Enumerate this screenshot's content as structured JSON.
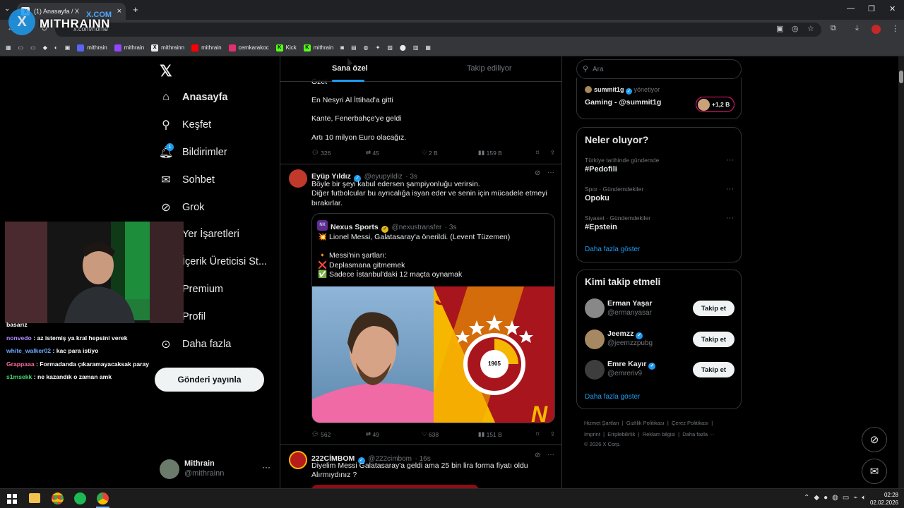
{
  "browser": {
    "tab_title": "(1) Anasayfa / X",
    "url": "x.com/home",
    "new_tab": "+",
    "bookmarks": [
      {
        "label": "mithrain",
        "color": "#5865f2"
      },
      {
        "label": "mithrain",
        "color": "#9146ff"
      },
      {
        "label": "mithrainn",
        "color": "#e7e9ea"
      },
      {
        "label": "mithrain",
        "color": "#ff0000"
      },
      {
        "label": "cemkarakoc",
        "color": "#e1306c"
      },
      {
        "label": "Kick",
        "color": "#53fc18"
      },
      {
        "label": "mithrain",
        "color": "#53fc18"
      }
    ]
  },
  "watermark": {
    "name": "MITHRAINN",
    "domain": "X.COM",
    "logo": "X"
  },
  "nav": {
    "items": [
      {
        "label": "Anasayfa",
        "icon": "home-icon"
      },
      {
        "label": "Keşfet",
        "icon": "search-icon"
      },
      {
        "label": "Bildirimler",
        "icon": "bell-icon",
        "badge": "1"
      },
      {
        "label": "Sohbet",
        "icon": "mail-icon"
      },
      {
        "label": "Grok",
        "icon": "grok-icon"
      },
      {
        "label": "Yer İşaretleri",
        "icon": "bookmark-icon"
      },
      {
        "label": "İçerik Üreticisi St...",
        "icon": "lightning-icon"
      },
      {
        "label": "Premium",
        "icon": "x-icon"
      },
      {
        "label": "Profil",
        "icon": "person-icon"
      },
      {
        "label": "Daha fazla",
        "icon": "more-circle-icon"
      }
    ],
    "post_button": "Gönderi yayınla",
    "account": {
      "name": "Mithrain",
      "handle": "@mithrainn"
    }
  },
  "chat": [
    {
      "user": "",
      "text": "basarız",
      "color": "#ffffff"
    },
    {
      "user": "nonvedo",
      "text": ": az istemiş ya kral hepsini verek",
      "color": "#b58cff"
    },
    {
      "user": "white_walker02",
      "text": ": kac para istiyo",
      "color": "#6fa8ff"
    },
    {
      "user": "Grappaaa",
      "text": ": Formadanda çıkaramayacaksak paray",
      "color": "#ff6b9a"
    },
    {
      "user": "s1msekk",
      "text": ": ne kazandık o zaman amk",
      "color": "#41d66f"
    }
  ],
  "feed": {
    "tabs": [
      "Sana özel",
      "Takip ediliyor"
    ],
    "tweet1": {
      "lines": [
        "Özet",
        "En Nesyri Al İttihad'a gitti",
        "Kante, Fenerbahçe'ye geldi",
        "Artı 10 milyon Euro olacağız."
      ],
      "replies": "326",
      "reposts": "45",
      "likes": "2 B",
      "views": "159 B"
    },
    "tweet2": {
      "name": "Eyüp Yıldız",
      "handle": "@eyupyildiz",
      "time": "· 3s",
      "text": "Böyle bir şeyi kabul edersen şampiyonluğu verirsin.\nDiğer futbolcular bu ayrıcalığa isyan eder ve senin için mücadele etmeyi bırakırlar.",
      "quote": {
        "name": "Nexus Sports",
        "handle": "@nexustransfer",
        "time": "· 3s",
        "lines": [
          "💥 Lionel Messi, Galatasaray'a önerildi. (Levent Tüzemen)",
          "🔸 Messi'nin şartları:",
          "❌ Deplasmana gitmemek",
          "✅ Sadece İstanbul'daki 12 maçta oynamak"
        ],
        "badge_year": "1905"
      },
      "replies": "562",
      "reposts": "49",
      "likes": "638",
      "views": "151 B"
    },
    "tweet3": {
      "name": "222CİMBOM",
      "handle": "@222cimbom",
      "time": "· 16s",
      "text": "Diyelim Messi Galatasaray'a geldi ama 25 bin lira forma fiyatı oldu Alırmıydınız ?"
    }
  },
  "right": {
    "search_placeholder": "Ara",
    "live": {
      "host": "summit1g",
      "role": "yönetiyor",
      "title": "Gaming - @summit1g",
      "count": "+1,2 B"
    },
    "trends_title": "Neler oluyor?",
    "trends": [
      {
        "meta": "Türkiye tarihinde gündemde",
        "name": "#Pedofili"
      },
      {
        "meta": "Spor · Gündemdekiler",
        "name": "Opoku"
      },
      {
        "meta": "Siyaset · Gündemdekiler",
        "name": "#Epstein"
      }
    ],
    "trends_more": "Daha fazla göster",
    "who_title": "Kimi takip etmeli",
    "who": [
      {
        "name": "Erman Yaşar",
        "handle": "@ermanyasar",
        "verified": false,
        "button": "Takip et"
      },
      {
        "name": "Jeemzz",
        "handle": "@jeemzzpubg",
        "verified": true,
        "button": "Takip et"
      },
      {
        "name": "Emre Kayır",
        "handle": "@emreriv9",
        "verified": true,
        "button": "Takip et"
      }
    ],
    "who_more": "Daha fazla göster",
    "footer": [
      "Hizmet Şartları",
      "Gizlilik Politikası",
      "Çerez Politikası",
      "Imprint",
      "Erişilebilirlik",
      "Reklam bilgisi",
      "Daha fazla ···",
      "© 2026 X Corp."
    ]
  },
  "taskbar": {
    "time": "02:28",
    "date": "02.02.2026"
  }
}
